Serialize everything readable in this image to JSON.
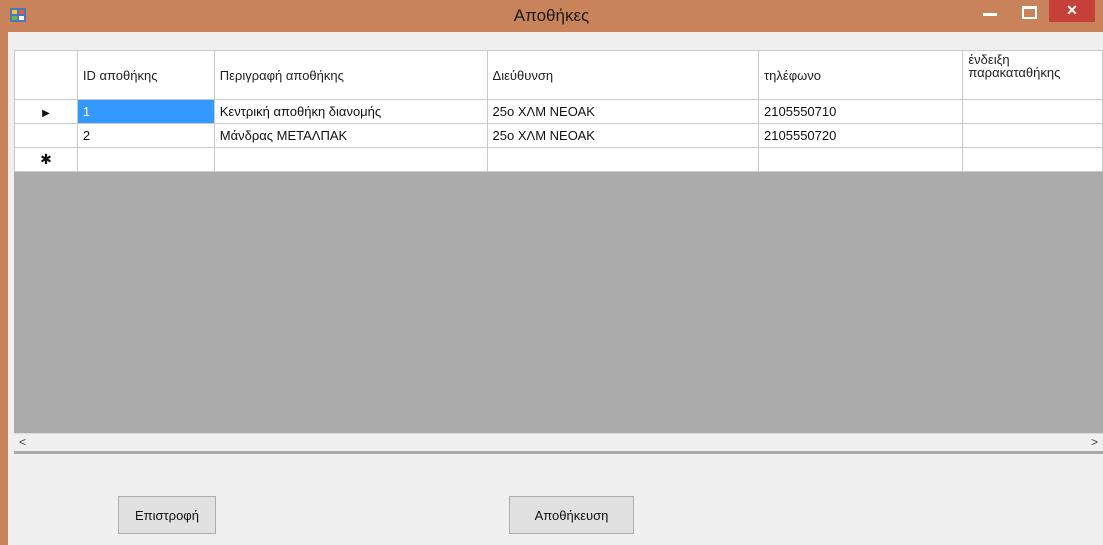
{
  "window": {
    "title": "Αποθήκες"
  },
  "grid": {
    "columns": [
      "ID αποθήκης",
      "Περιγραφή αποθήκης",
      "Διεύθυνση",
      "τηλέφωνο",
      "ένδειξη παρακαταθήκης"
    ],
    "rows": [
      {
        "id": "1",
        "description": "Κεντρική αποθήκη διανομής",
        "address": "25ο ΧΛΜ ΝΕΟΑΚ",
        "phone": "2105550710",
        "consignment": ""
      },
      {
        "id": "2",
        "description": "Μάνδρας ΜΕΤΑΛΠΑΚ",
        "address": "25ο ΧΛΜ ΝΕΟΑΚ",
        "phone": "2105550720",
        "consignment": ""
      }
    ]
  },
  "buttons": {
    "back": "Επιστροφή",
    "save": "Αποθήκευση"
  },
  "icons": {
    "current_row": "▶",
    "new_row": "✱",
    "scroll_left": "<",
    "scroll_right": ">",
    "minimize": "–",
    "close": "✕"
  }
}
